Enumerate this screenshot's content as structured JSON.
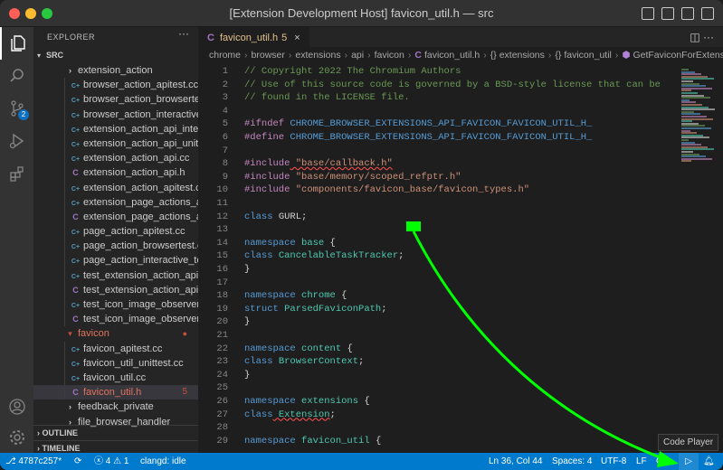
{
  "window": {
    "title": "[Extension Development Host] favicon_util.h — src"
  },
  "explorer": {
    "header": "EXPLORER",
    "more": "···",
    "root": "SRC",
    "items": [
      {
        "label": "extension_action",
        "type": "folder",
        "level": 1
      },
      {
        "label": "browser_action_apitest.cc",
        "type": "cc",
        "level": 2
      },
      {
        "label": "browser_action_browsertest.cc",
        "type": "cc",
        "level": 2
      },
      {
        "label": "browser_action_interactive_test.cc",
        "type": "cc",
        "level": 2
      },
      {
        "label": "extension_action_api_interactive_test.cc",
        "type": "cc",
        "level": 2
      },
      {
        "label": "extension_action_api_unittest.cc",
        "type": "cc",
        "level": 2
      },
      {
        "label": "extension_action_api.cc",
        "type": "cc",
        "level": 2
      },
      {
        "label": "extension_action_api.h",
        "type": "h",
        "level": 2
      },
      {
        "label": "extension_action_apitest.cc",
        "type": "cc",
        "level": 2
      },
      {
        "label": "extension_page_actions_apitest.cc",
        "type": "cc",
        "level": 2
      },
      {
        "label": "extension_page_actions_api.h",
        "type": "h",
        "level": 2
      },
      {
        "label": "page_action_apitest.cc",
        "type": "cc",
        "level": 2
      },
      {
        "label": "page_action_browsertest.cc",
        "type": "cc",
        "level": 2
      },
      {
        "label": "page_action_interactive_test.cc",
        "type": "cc",
        "level": 2
      },
      {
        "label": "test_extension_action_api_observer.cc",
        "type": "cc",
        "level": 2
      },
      {
        "label": "test_extension_action_api_observer.h",
        "type": "h",
        "level": 2
      },
      {
        "label": "test_icon_image_observer.cc",
        "type": "cc",
        "level": 2
      },
      {
        "label": "test_icon_image_observer.h",
        "type": "h",
        "level": 2
      },
      {
        "label": "favicon",
        "type": "folder-open",
        "level": 1
      },
      {
        "label": "favicon_apitest.cc",
        "type": "cc",
        "level": 2
      },
      {
        "label": "favicon_util_unittest.cc",
        "type": "cc",
        "level": 2
      },
      {
        "label": "favicon_util.cc",
        "type": "cc",
        "level": 2
      },
      {
        "label": "favicon_util.h",
        "type": "h",
        "level": 2,
        "selected": true,
        "count": "5"
      },
      {
        "label": "feedback_private",
        "type": "folder",
        "level": 1
      },
      {
        "label": "file_browser_handler",
        "type": "folder",
        "level": 1
      }
    ],
    "outline": "OUTLINE",
    "timeline": "TIMELINE"
  },
  "tab": {
    "icon": "C",
    "label": "favicon_util.h",
    "count": "5",
    "close": "×"
  },
  "breadcrumbs": [
    "chrome",
    "browser",
    "extensions",
    "api",
    "favicon",
    "favicon_util.h",
    "{} extensions",
    "{} favicon_util",
    "GetFaviconForExtensionRequest"
  ],
  "code": [
    {
      "n": "1",
      "t": "// Copyright 2022 The Chromium Authors",
      "k": "cmt"
    },
    {
      "n": "2",
      "t": "// Use of this source code is governed by a BSD-style license that can be",
      "k": "cmt"
    },
    {
      "n": "3",
      "t": "// found in the LICENSE file.",
      "k": "cmt"
    },
    {
      "n": "4",
      "t": "",
      "k": ""
    },
    {
      "n": "5",
      "a": "#ifndef",
      "b": " CHROME_BROWSER_EXTENSIONS_API_FAVICON_FAVICON_UTIL_H_",
      "k": "pp-mac"
    },
    {
      "n": "6",
      "a": "#define",
      "b": " CHROME_BROWSER_EXTENSIONS_API_FAVICON_FAVICON_UTIL_H_",
      "k": "pp-mac"
    },
    {
      "n": "7",
      "t": "",
      "k": ""
    },
    {
      "n": "8",
      "a": "#include",
      "b": " \"base/callback.h\"",
      "k": "pp-str-sq"
    },
    {
      "n": "9",
      "a": "#include",
      "b": " \"base/memory/scoped_refptr.h\"",
      "k": "pp-str"
    },
    {
      "n": "10",
      "a": "#include",
      "b": " \"components/favicon_base/favicon_types.h\"",
      "k": "pp-str"
    },
    {
      "n": "11",
      "t": "",
      "k": ""
    },
    {
      "n": "12",
      "a": "class",
      "b": " GURL;",
      "k": "kw-txt"
    },
    {
      "n": "13",
      "t": "",
      "k": ""
    },
    {
      "n": "14",
      "a": "namespace",
      "b": " base",
      "c": " {",
      "k": "kw-ty"
    },
    {
      "n": "15",
      "a": "class",
      "b": " CancelableTaskTracker",
      "c": ";",
      "k": "kw-ty"
    },
    {
      "n": "16",
      "t": "}",
      "k": "txt"
    },
    {
      "n": "17",
      "t": "",
      "k": ""
    },
    {
      "n": "18",
      "a": "namespace",
      "b": " chrome",
      "c": " {",
      "k": "kw-ty"
    },
    {
      "n": "19",
      "a": "struct",
      "b": " ParsedFaviconPath",
      "c": ";",
      "k": "kw-ty"
    },
    {
      "n": "20",
      "t": "}",
      "k": "txt"
    },
    {
      "n": "21",
      "t": "",
      "k": ""
    },
    {
      "n": "22",
      "a": "namespace",
      "b": " content",
      "c": " {",
      "k": "kw-ty"
    },
    {
      "n": "23",
      "a": "class",
      "b": " BrowserContext",
      "c": ";",
      "k": "kw-ty"
    },
    {
      "n": "24",
      "t": "}",
      "k": "txt"
    },
    {
      "n": "25",
      "t": "",
      "k": ""
    },
    {
      "n": "26",
      "a": "namespace",
      "b": " extensions",
      "c": " {",
      "k": "kw-ty"
    },
    {
      "n": "27",
      "a": "class",
      "b": " Extension",
      "c": ";",
      "k": "kw-ty"
    },
    {
      "n": "28",
      "t": "",
      "k": ""
    },
    {
      "n": "29",
      "a": "namespace",
      "b": " favicon_util",
      "c": " {",
      "k": "kw-ty"
    }
  ],
  "status": {
    "branch": "4787c257*",
    "errors": "4",
    "warnings": "1",
    "clangd": "clangd: idle",
    "position": "Ln 36, Col 44",
    "spaces": "Spaces: 4",
    "encoding": "UTF-8",
    "eol": "LF",
    "language": "C++"
  },
  "tooltip": "Code Player",
  "scm_badge": "2",
  "colors": {
    "accent": "#007acc",
    "annotation": "#00ff00"
  }
}
